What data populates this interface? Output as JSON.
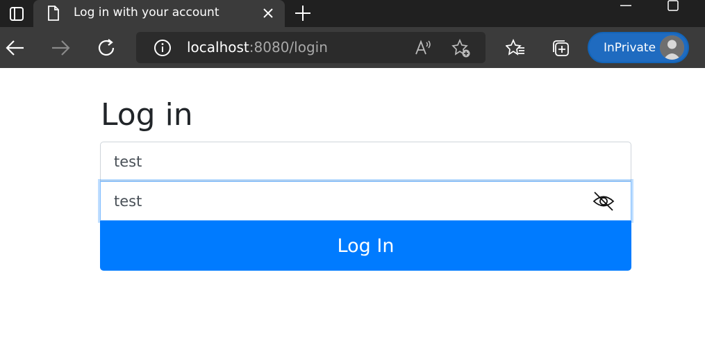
{
  "browser": {
    "tab_title": "Log in with your account",
    "url_host": "localhost",
    "url_path": ":8080/login",
    "inprivate_label": "InPrivate",
    "icons": [
      "tab-actions-icon",
      "page-icon",
      "close-icon",
      "plus-icon",
      "minimize-icon",
      "maximize-icon",
      "back-arrow-icon",
      "forward-arrow-icon",
      "refresh-icon",
      "info-icon",
      "read-aloud-icon",
      "add-favorite-icon",
      "favorites-icon",
      "collections-icon",
      "avatar-icon"
    ]
  },
  "page": {
    "heading": "Log in",
    "username_value": "test",
    "password_value": "test",
    "submit_label": "Log In",
    "accent_color": "#007bff"
  }
}
